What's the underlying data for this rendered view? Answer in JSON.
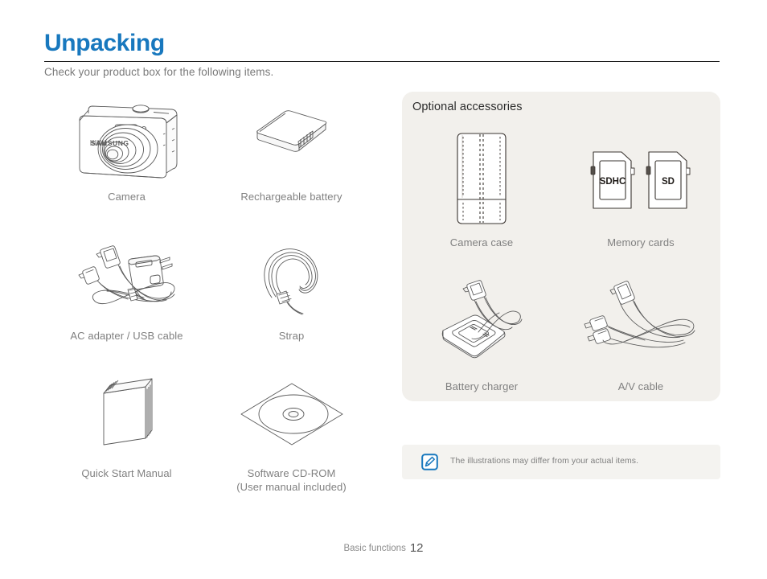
{
  "header": {
    "title": "Unpacking",
    "subtitle": "Check your product box for the following items.",
    "title_color": "#1878be"
  },
  "included_items": [
    {
      "label": "Camera",
      "icon": "camera-illustration"
    },
    {
      "label": "Rechargeable battery",
      "icon": "battery-illustration"
    },
    {
      "label": "AC adapter / USB cable",
      "icon": "ac-adapter-usb-cable-illustration"
    },
    {
      "label": "Strap",
      "icon": "strap-illustration"
    },
    {
      "label": "Quick Start Manual",
      "icon": "manual-illustration"
    },
    {
      "label": "Software CD-ROM\n(User manual included)",
      "icon": "cd-rom-illustration"
    }
  ],
  "included_items_labels": {
    "camera": "Camera",
    "battery": "Rechargeable battery",
    "adapter": "AC adapter / USB cable",
    "strap": "Strap",
    "manual": "Quick Start Manual",
    "cdrom_line1": "Software CD-ROM",
    "cdrom_line2": "(User manual included)"
  },
  "optional": {
    "title": "Optional accessories",
    "background_color": "#f2f0ec",
    "items": {
      "case": "Camera case",
      "memory": "Memory cards",
      "charger": "Battery charger",
      "av": "A/V cable"
    },
    "memory_card_labels": {
      "sdhc": "SDHC",
      "sd": "SD"
    }
  },
  "note": {
    "icon": "note-pen-icon",
    "icon_color": "#1878be",
    "text": "The illustrations may differ from your actual items."
  },
  "footer": {
    "section": "Basic functions",
    "page": "12"
  }
}
